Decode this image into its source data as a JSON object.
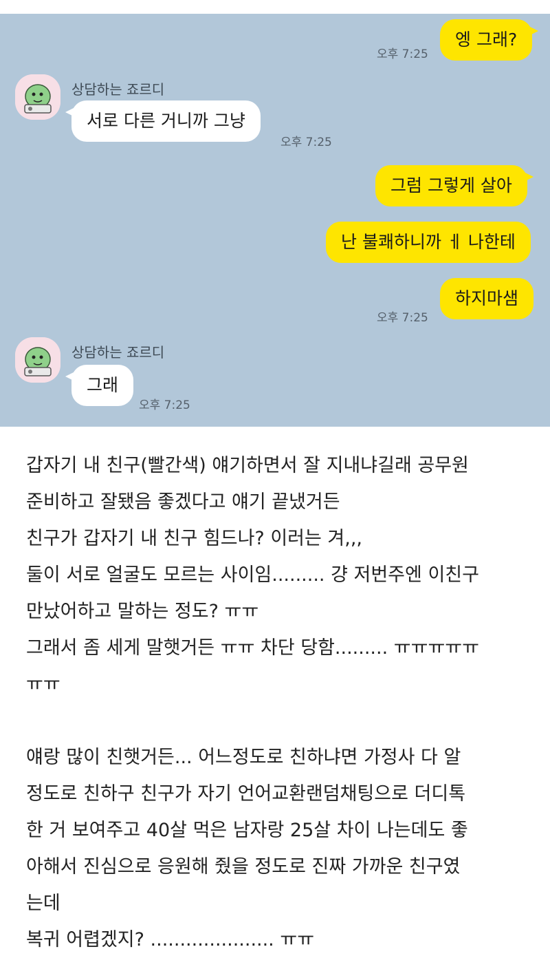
{
  "chat": {
    "messages": [
      {
        "sender": "",
        "text": "엥 그래?",
        "time": "오후 7:25"
      },
      {
        "sender": "상담하는 죠르디",
        "text": "서로 다른 거니까 그냥",
        "time": "오후 7:25"
      },
      {
        "sender": "",
        "text": "그럼 그렇게 살아",
        "time": ""
      },
      {
        "sender": "",
        "text": "난 불쾌하니까 ㅔ 나한테",
        "time": ""
      },
      {
        "sender": "",
        "text": "하지마샘",
        "time": "오후 7:25"
      },
      {
        "sender": "상담하는 죠르디",
        "text": "그래",
        "time": "오후 7:25"
      }
    ],
    "avatar_icon": "jordy-dinosaur-avatar-icon",
    "colors": {
      "background": "#b2c7d9",
      "my_bubble": "#fee500",
      "other_bubble": "#ffffff"
    }
  },
  "post": {
    "paragraph1": [
      "갑자기 내 친구(빨간색) 얘기하면서 잘 지내냐길래 공무원",
      "준비하고 잘됐음 좋겠다고 얘기 끝냈거든",
      "친구가 갑자기 내 친구 힘드나? 이러는 겨,,,",
      "둘이 서로 얼굴도 모르는 사이임......... 걍 저번주엔 이친구",
      "만났어하고 말하는 정도? ㅠㅠ",
      "그래서 좀 세게 말햇거든 ㅠㅠ 차단 당함......... ㅠㅠㅠㅠㅠ",
      "ㅠㅠ"
    ],
    "paragraph2": [
      "얘랑 많이 친햇거든... 어느정도로 친하냐면 가정사 다 알",
      "정도로 친하구 친구가 자기 언어교환랜덤채팅으로 더디톡",
      "한 거 보여주고 40살 먹은 남자랑 25살 차이 나는데도 좋",
      "아해서 진심으로 응원해 줬을 정도로 진짜 가까운 친구였",
      "는데",
      "복귀 어렵겠지? ..................... ㅠㅠ"
    ]
  }
}
